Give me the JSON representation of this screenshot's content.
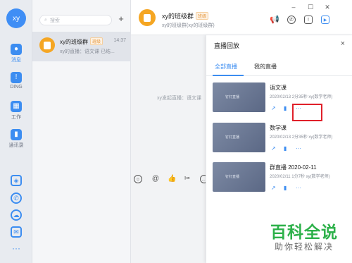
{
  "nav": {
    "avatar_text": "xy",
    "items": [
      {
        "label": "消息",
        "icon": "message-icon",
        "active": true
      },
      {
        "label": "DING",
        "icon": "ding-icon",
        "active": false
      },
      {
        "label": "工作",
        "icon": "work-grid-icon",
        "active": false
      },
      {
        "label": "通讯录",
        "icon": "contacts-icon",
        "active": false
      }
    ],
    "bottom_icons": [
      "cube-icon",
      "phone-icon",
      "cloud-icon",
      "mail-icon",
      "more-icon"
    ]
  },
  "convlist": {
    "search_placeholder": "搜索",
    "add_label": "+",
    "items": [
      {
        "name": "xy的班级群",
        "badge": "班级",
        "time": "14:37",
        "preview": "xy的直播：语文课 已结..."
      }
    ]
  },
  "chat": {
    "title": "xy的班级群",
    "badge": "班级",
    "subtitle": "xy的班级群(xy的班级群)",
    "messages": [
      "xy发起直播：语文课"
    ],
    "header_icons": [
      "megaphone-icon",
      "phone-icon",
      "ding-icon",
      "live-icon"
    ],
    "toolbar_icons": [
      "emoji-icon",
      "mention-icon",
      "thumb-up-icon",
      "scissors-icon",
      "more-circle-icon"
    ]
  },
  "panel": {
    "title": "直播回放",
    "close_label": "×",
    "tabs": [
      "全部直播",
      "我的直播"
    ],
    "records": [
      {
        "title": "语文课",
        "meta": "2020/02/13 2分35秒 xy(数学老师)",
        "thumb_text": "钉钉直播"
      },
      {
        "title": "数学课",
        "meta": "2020/02/13 2分35秒 xy(数学老师)",
        "thumb_text": "钉钉直播"
      },
      {
        "title": "群直播 2020-02-11",
        "meta": "2020/02/11 1分7秒 xy(数学老师)",
        "thumb_text": "钉钉直播"
      }
    ],
    "record_actions": [
      "share-icon",
      "stats-icon",
      "more-icon"
    ],
    "more_label": "···"
  },
  "watermark": {
    "main": "百科全说",
    "sub": "助你轻松解决"
  },
  "colors": {
    "accent": "#3c8df1",
    "group_avatar": "#f5a623",
    "highlight": "#e0202a",
    "watermark": "#2db14a"
  }
}
